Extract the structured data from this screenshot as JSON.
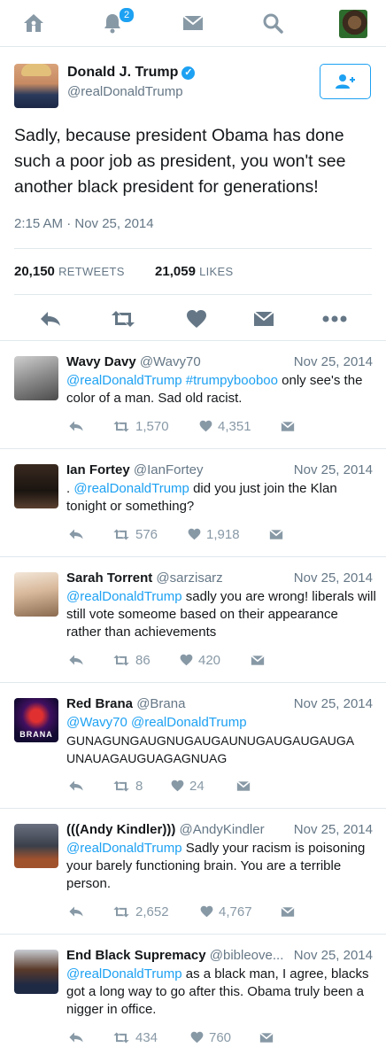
{
  "nav": {
    "icons": [
      "home-icon",
      "bell-icon",
      "mail-icon",
      "search-icon",
      "avatar"
    ],
    "notification_count": "2"
  },
  "tweet": {
    "name": "Donald J. Trump",
    "handle": "@realDonaldTrump",
    "text": "Sadly, because president Obama has done such a poor job as president, you won't see another black president for generations!",
    "time": "2:15 AM · Nov 25, 2014",
    "retweets": "20,150",
    "retweets_label": "RETWEETS",
    "likes": "21,059",
    "likes_label": "LIKES"
  },
  "colors": {
    "accent": "#1da1f2",
    "icon": "#657786",
    "muted": "#8899a6",
    "divider": "#e1e8ed"
  },
  "replies": [
    {
      "name": "Wavy Davy",
      "handle": "@Wavy70",
      "date": "Nov 25, 2014",
      "mention": "@realDonaldTrump",
      "hashtag": "#trumpybooboo",
      "text": "only see's the color of a man. Sad old racist.",
      "retweets": "1,570",
      "likes": "4,351"
    },
    {
      "name": "Ian Fortey",
      "handle": "@IanFortey",
      "date": "Nov 25, 2014",
      "prefix": ".",
      "mention": "@realDonaldTrump",
      "text": "did you just join the Klan tonight or something?",
      "retweets": "576",
      "likes": "1,918"
    },
    {
      "name": "Sarah Torrent",
      "handle": "@sarzisarz",
      "date": "Nov 25, 2014",
      "mention": "@realDonaldTrump",
      "text": "sadly you are wrong! liberals will still vote someome based on their appearance rather than achievements",
      "retweets": "86",
      "likes": "420"
    },
    {
      "name": "Red Brana",
      "handle": "@Brana",
      "date": "Nov 25, 2014",
      "mention": "@Wavy70 @realDonaldTrump",
      "line1": "GUNAGUNGAUGNUGAUGAUNUGAUGAUGAUGA",
      "line2": "UNAUAGAUGUAGAGNUAG",
      "avatar_text": "BRANA",
      "retweets": "8",
      "likes": "24"
    },
    {
      "name": "(((Andy Kindler)))",
      "handle": "@AndyKindler",
      "date": "Nov 25, 2014",
      "mention": "@realDonaldTrump",
      "text": "Sadly your racism is poisoning your barely functioning brain. You are a terrible person.",
      "retweets": "2,652",
      "likes": "4,767"
    },
    {
      "name": "End Black Supremacy",
      "handle": "@bibleove...",
      "date": "Nov 25, 2014",
      "mention": "@realDonaldTrump",
      "text": "as a black man, I agree, blacks got a long way to go after this. Obama truly been a nigger in office.",
      "retweets": "434",
      "likes": "760"
    }
  ]
}
